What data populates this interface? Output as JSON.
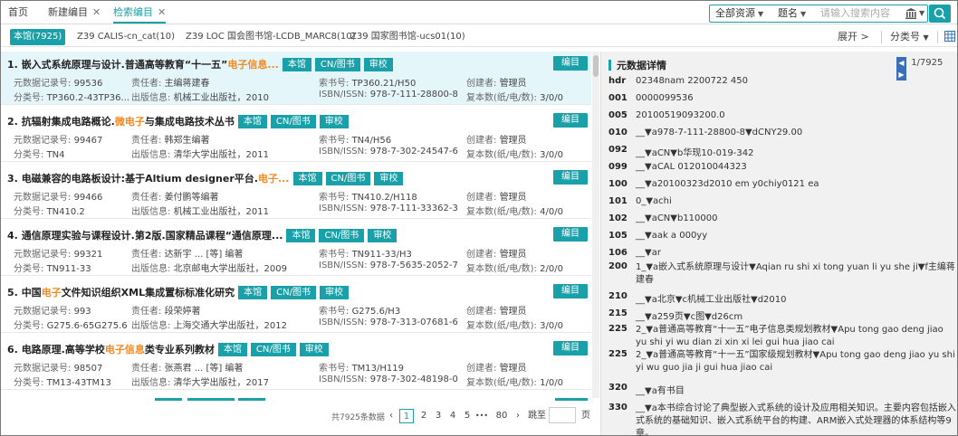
{
  "tabs": [
    {
      "label": "首页"
    },
    {
      "label": "新建编目",
      "close": "✕"
    },
    {
      "label": "检索编目",
      "close": "✕"
    }
  ],
  "search": {
    "scope": "全部资源",
    "field": "题名",
    "placeholder": "请输入搜索内容"
  },
  "sources": [
    {
      "label": "本馆(7925)"
    },
    {
      "label": "Z39 CALIS-cn_cat(10)"
    },
    {
      "label": "Z39 LOC 国会图书馆-LCDB_MARC8(10)"
    },
    {
      "label": "Z39 国家图书馆-ucs01(10)"
    }
  ],
  "toolbar": {
    "expand": "展开 >",
    "classify": "分类号"
  },
  "field_labels": {
    "record_no": "元数据记录号:",
    "author": "责任者:",
    "call_no": "索书号:",
    "creator": "创建者:",
    "class_no": "分类号:",
    "publisher": "出版信息:",
    "isbn": "ISBN/ISSN:",
    "copies": "复本数(纸/电/数):"
  },
  "edit_label": "编目",
  "records": [
    {
      "num": "1.",
      "t1": "嵌入式系统原理与设计.普通高等教育“十一五”",
      "hl": "电子信息...",
      "t2": "",
      "badges": [
        "本馆",
        "CN/图书",
        "审校"
      ],
      "record_no": "99536",
      "author": "主编蒋建春",
      "call_no": "TP360.21/H50",
      "creator": "管理员",
      "class_no": "TP360.2-43TP36...",
      "publisher": "机械工业出版社，2010",
      "isbn": "978-7-111-28800-8",
      "copies": "3/0/0"
    },
    {
      "num": "2.",
      "t1": "抗辐射集成电路概论.",
      "hl": "微电子",
      "t2": "与集成电路技术丛书",
      "badges": [
        "本馆",
        "CN/图书",
        "审校"
      ],
      "record_no": "99467",
      "author": "韩郑生编著",
      "call_no": "TN4/H56",
      "creator": "管理员",
      "class_no": "TN4",
      "publisher": "清华大学出版社，2011",
      "isbn": "978-7-302-24547-6",
      "copies": "3/0/0"
    },
    {
      "num": "3.",
      "t1": "电磁兼容的电路板设计:基于Altium designer平台.",
      "hl": "电子...",
      "t2": "",
      "badges": [
        "本馆",
        "CN/图书",
        "审校"
      ],
      "record_no": "99466",
      "author": "姜付鹏等编著",
      "call_no": "TN410.2/H118",
      "creator": "管理员",
      "class_no": "TN410.2",
      "publisher": "机械工业出版社，2011",
      "isbn": "978-7-111-33362-3",
      "copies": "4/0/0"
    },
    {
      "num": "4.",
      "t1": "通信原理实验与课程设计.第2版.国家精品课程“通信原理...",
      "hl": "",
      "t2": "",
      "badges": [
        "本馆",
        "CN/图书",
        "审校"
      ],
      "record_no": "99321",
      "author": "达新宇 ... [等] 编著",
      "call_no": "TN911-33/H3",
      "creator": "管理员",
      "class_no": "TN911-33",
      "publisher": "北京邮电大学出版社，2009",
      "isbn": "978-7-5635-2052-7",
      "copies": "2/0/0"
    },
    {
      "num": "5.",
      "t1": "中国",
      "hl": "电子",
      "t2": "文件知识组织XML集成置标标准化研究",
      "badges": [
        "本馆",
        "CN/图书",
        "审校"
      ],
      "record_no": "993",
      "author": "段荣婷著",
      "call_no": "G275.6/H3",
      "creator": "管理员",
      "class_no": "G275.6-65G275.6",
      "publisher": "上海交通大学出版社，2012",
      "isbn": "978-7-313-07681-6",
      "copies": "3/0/0"
    },
    {
      "num": "6.",
      "t1": "电路原理.高等学校",
      "hl": "电子信息",
      "t2": "类专业系列教材",
      "badges": [
        "本馆",
        "CN/图书",
        "审校"
      ],
      "record_no": "98507",
      "author": "张燕君 ... [等] 编著",
      "call_no": "TM13/H119",
      "creator": "管理员",
      "class_no": "TM13-43TM13",
      "publisher": "清华大学出版社，2017",
      "isbn": "978-7-302-48198-0",
      "copies": "1/0/0"
    }
  ],
  "pager": {
    "total": "共7925条数据",
    "prev": "‹",
    "pages": [
      "1",
      "2",
      "3",
      "4",
      "5",
      "•••",
      "80"
    ],
    "next": "›",
    "jump_label": "跳至",
    "page_suffix": "页"
  },
  "detail": {
    "title": "元数据详情",
    "position": "1/7925",
    "fields": [
      {
        "tag": "hdr",
        "value": "02348nam 2200722 450"
      },
      {
        "tag": "001",
        "value": "0000099536"
      },
      {
        "tag": "005",
        "value": "20100519093200.0"
      },
      {
        "tag": "010",
        "value": "__▼a978-7-111-28800-8▼dCNY29.00"
      },
      {
        "tag": "092",
        "value": "__▼aCN▼b华现10-019-342"
      },
      {
        "tag": "099",
        "value": "__▼aCAL 012010044323"
      },
      {
        "tag": "100",
        "value": "__▼a20100323d2010 em y0chiy0121 ea"
      },
      {
        "tag": "101",
        "value": "0_▼achi"
      },
      {
        "tag": "102",
        "value": "__▼aCN▼b110000"
      },
      {
        "tag": "105",
        "value": "__▼aak a 000yy"
      },
      {
        "tag": "106",
        "value": "__▼ar"
      },
      {
        "tag": "200",
        "value": "1_▼a嵌入式系统原理与设计▼Aqian ru shi xi tong yuan li yu she ji▼f主编蒋建春"
      },
      {
        "tag": "210",
        "value": "__▼a北京▼c机械工业出版社▼d2010"
      },
      {
        "tag": "215",
        "value": "__▼a259页▼c图▼d26cm"
      },
      {
        "tag": "225",
        "value": "2_▼a普通高等教育“十一五”电子信息类规划教材▼Apu tong gao deng jiao yu shi yi wu dian zi xin xi lei gui hua jiao cai"
      },
      {
        "tag": "225",
        "value": "2_▼a普通高等教育“十一五”国家级规划教材▼Apu tong gao deng jiao yu shi yi wu guo jia ji gui hua jiao cai"
      },
      {
        "tag": "320",
        "value": "__▼a有书目"
      },
      {
        "tag": "330",
        "value": "__▼a本书综合讨论了典型嵌入式系统的设计及应用相关知识。主要内容包括嵌入式系统的基础知识、嵌入式系统平台的构建、ARM嵌入式处理器的体系结构等9章。"
      }
    ]
  },
  "colors": {
    "accent": "#1aa0a8",
    "highlight": "#f08a24",
    "selected_row": "#e5f6fa",
    "nav": "#3a6fb8"
  }
}
